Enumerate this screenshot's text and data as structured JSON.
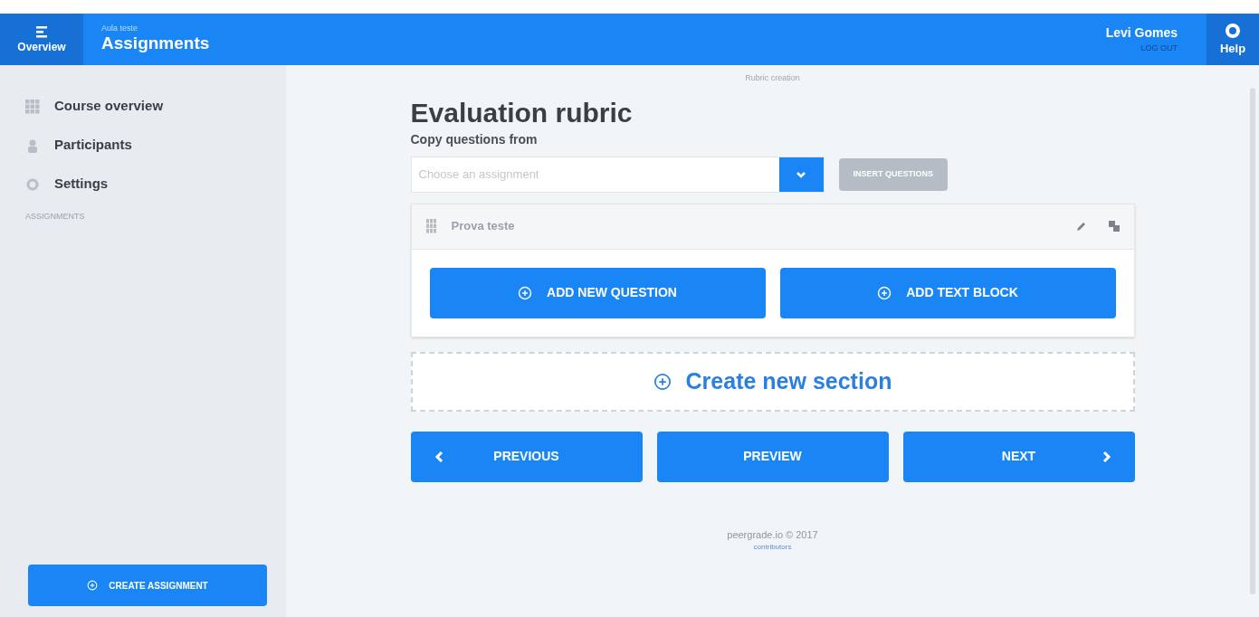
{
  "header": {
    "menu_label": "Overview",
    "course": "Aula teste",
    "title": "Assignments",
    "user": "Levi Gomes",
    "logout": "LOG OUT",
    "help": "Help"
  },
  "sidebar": {
    "items": [
      {
        "label": "Course overview",
        "kind": "grid"
      },
      {
        "label": "Participants",
        "kind": "person"
      },
      {
        "label": "Settings",
        "kind": "gear"
      }
    ],
    "section_label": "ASSIGNMENTS",
    "create_button": "CREATE ASSIGNMENT"
  },
  "breadcrumb": "Rubric creation",
  "title": "Evaluation rubric",
  "copy_label": "Copy questions from",
  "select": {
    "placeholder": "Choose an assignment"
  },
  "insert_button": {
    "label": "INSERT QUESTIONS",
    "disabled": true
  },
  "section": {
    "title": "Prova teste",
    "buttons": [
      "ADD NEW QUESTION",
      "ADD TEXT BLOCK"
    ]
  },
  "create_section": "Create new section",
  "nav": [
    {
      "label": "PREVIOUS",
      "kind": "prev"
    },
    {
      "label": "PREVIEW",
      "kind": "plain"
    },
    {
      "label": "NEXT",
      "kind": "next"
    }
  ],
  "footer": {
    "copyright": "peergrade.io © 2017",
    "link": "contributors"
  }
}
